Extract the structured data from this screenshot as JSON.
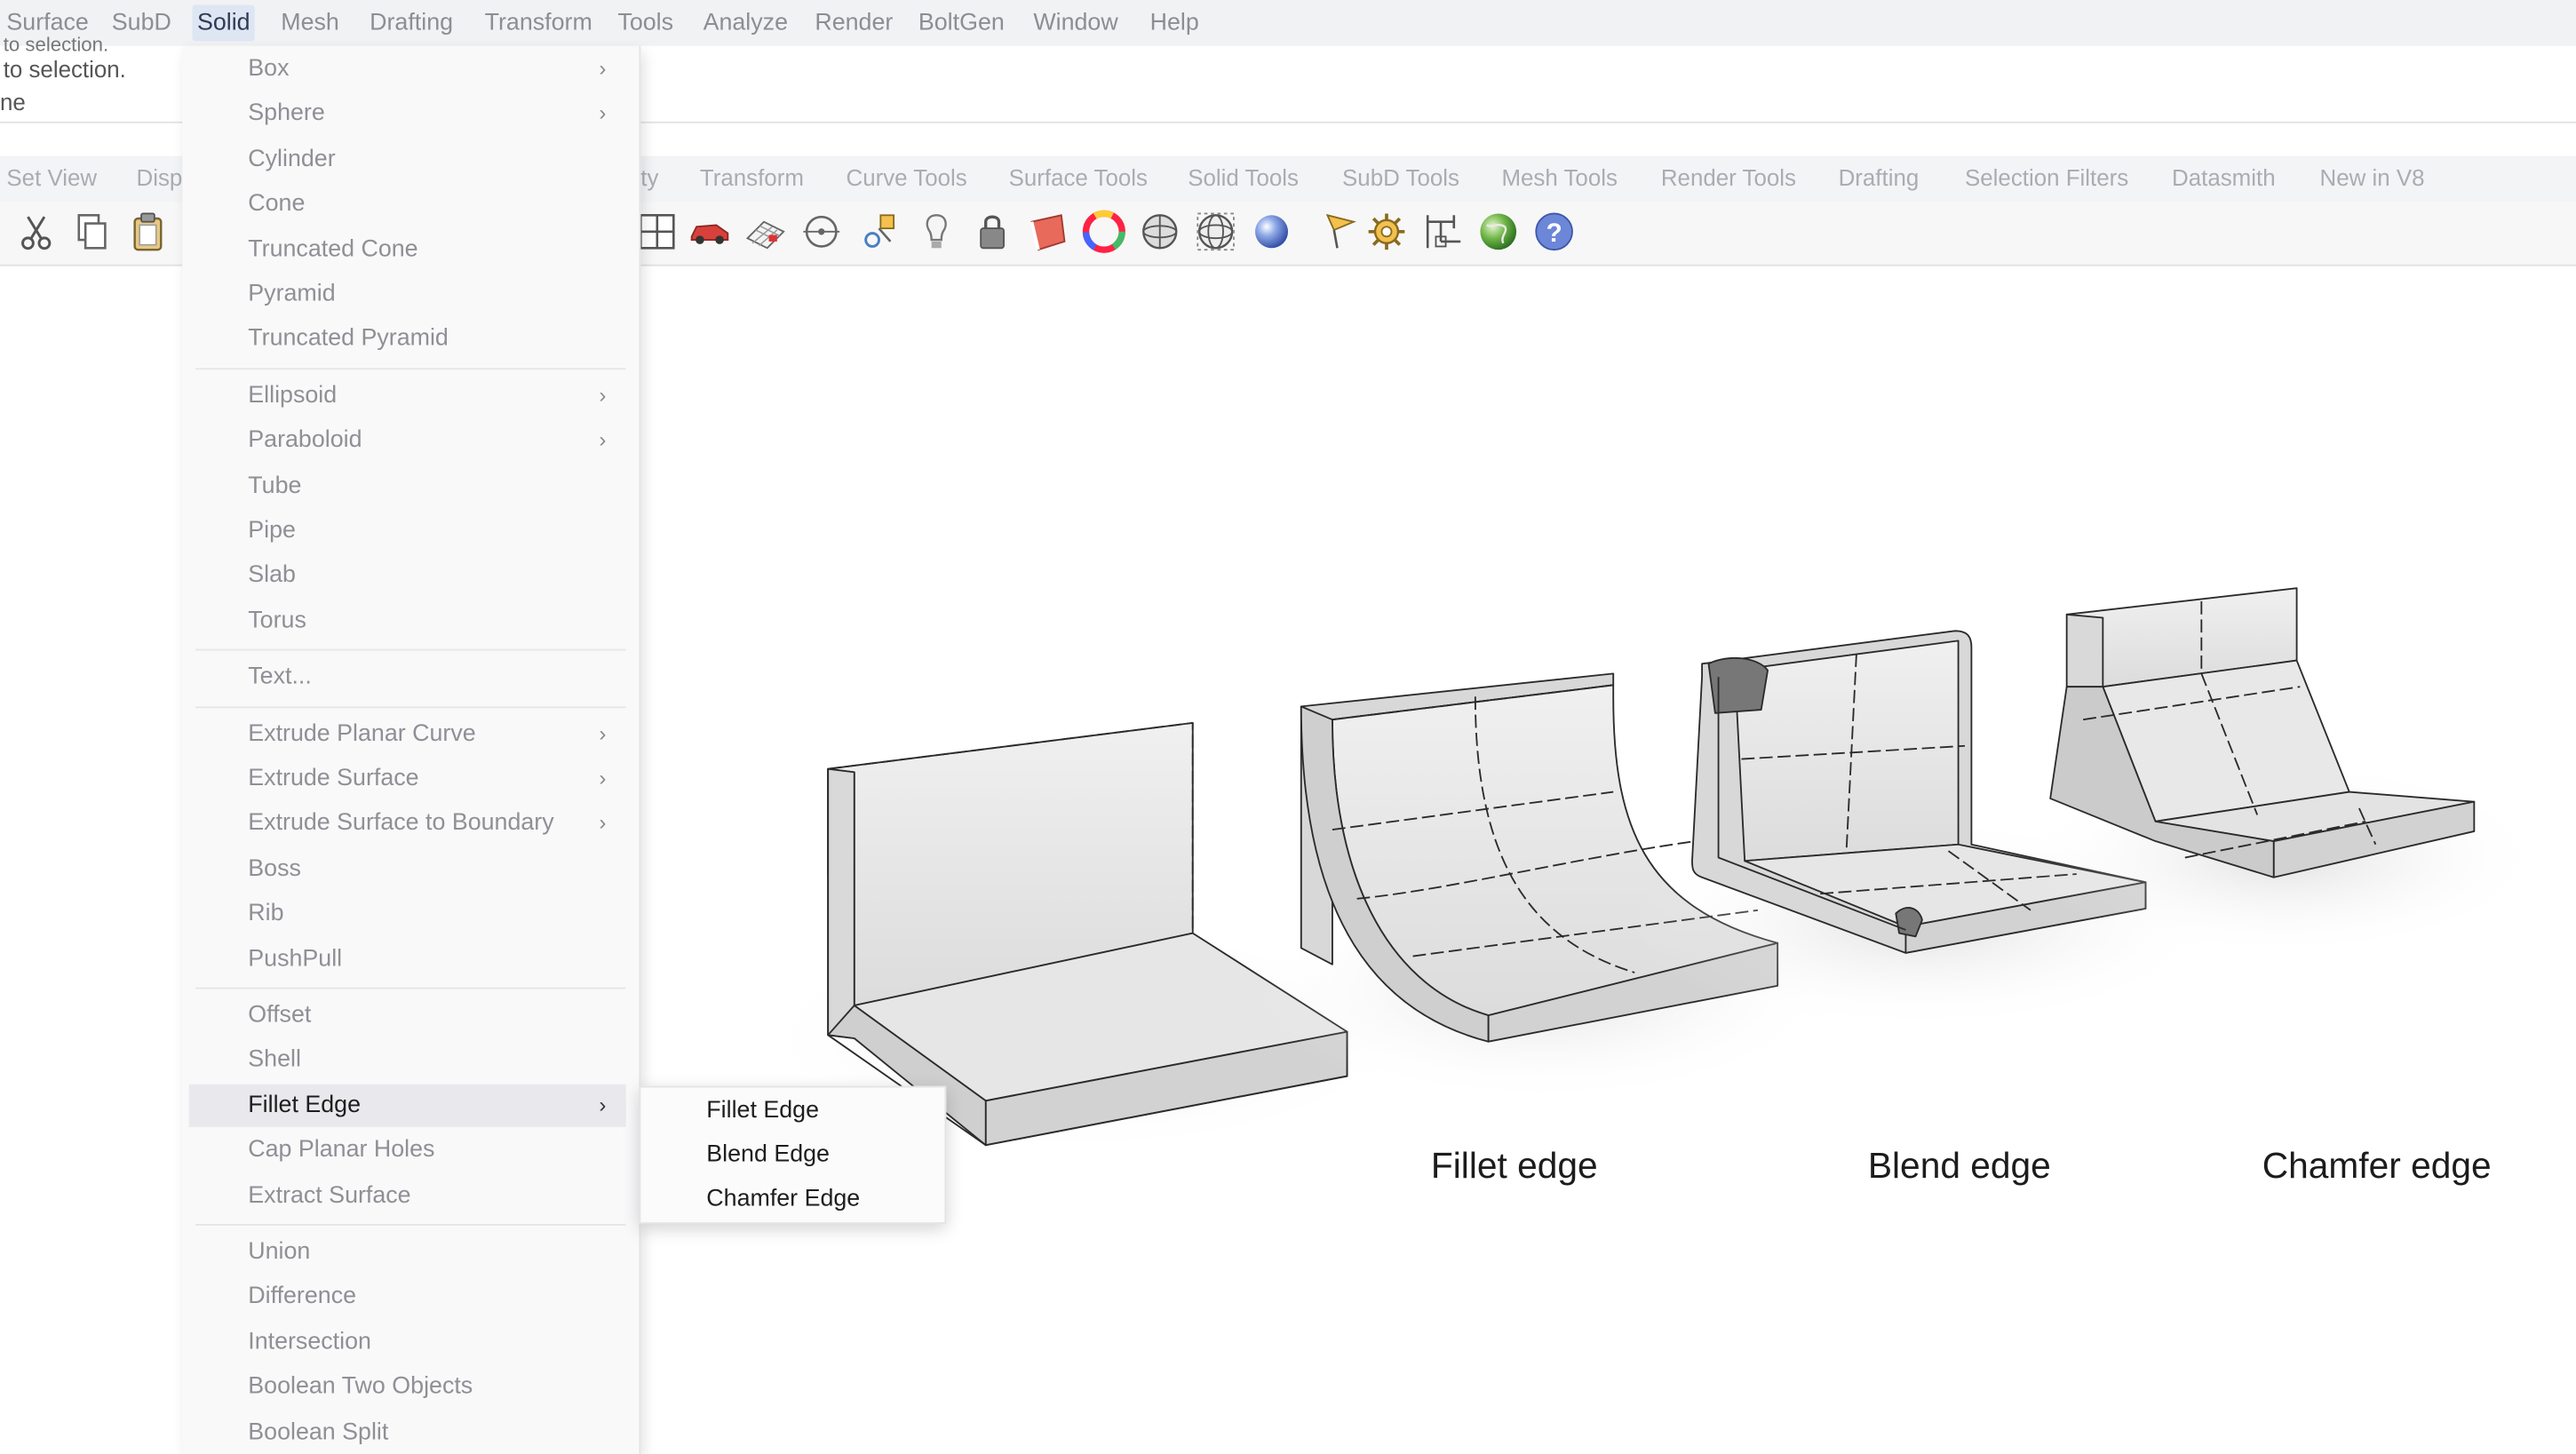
{
  "menubar": {
    "items": [
      "Surface",
      "SubD",
      "Solid",
      "Mesh",
      "Drafting",
      "Transform",
      "Tools",
      "Analyze",
      "Render",
      "BoltGen",
      "Window",
      "Help"
    ],
    "active": "Solid"
  },
  "command_history": {
    "line_top_partial": "to selection.",
    "line1": "to selection.",
    "line2": "ne"
  },
  "toolbar_tabs": {
    "left_items": [
      "Set View",
      "Disp"
    ],
    "partial_item": "ty",
    "items": [
      "Transform",
      "Curve Tools",
      "Surface Tools",
      "Solid Tools",
      "SubD Tools",
      "Mesh Tools",
      "Render Tools",
      "Drafting",
      "Selection Filters",
      "Datasmith",
      "New in V8"
    ]
  },
  "toolbar_icons": [
    "cut-icon",
    "copy-icon",
    "paste-icon",
    "four-viewports-icon",
    "car-icon",
    "grid-icon",
    "osnap-icon",
    "gumball-icon",
    "lightbulb-icon",
    "lock-icon",
    "layer-color-icon",
    "color-wheel-icon",
    "shaded-sphere-icon",
    "wireframe-sphere-icon",
    "rendered-sphere-icon",
    "flag-icon",
    "gear-icon",
    "dimension-icon",
    "globe-icon",
    "help-icon"
  ],
  "solid_menu": {
    "groups": [
      [
        {
          "label": "Box",
          "submenu": true
        },
        {
          "label": "Sphere",
          "submenu": true
        },
        {
          "label": "Cylinder",
          "submenu": false
        },
        {
          "label": "Cone",
          "submenu": false
        },
        {
          "label": "Truncated Cone",
          "submenu": false
        },
        {
          "label": "Pyramid",
          "submenu": false
        },
        {
          "label": "Truncated Pyramid",
          "submenu": false
        }
      ],
      [
        {
          "label": "Ellipsoid",
          "submenu": true
        },
        {
          "label": "Paraboloid",
          "submenu": true
        },
        {
          "label": "Tube",
          "submenu": false
        },
        {
          "label": "Pipe",
          "submenu": false
        },
        {
          "label": "Slab",
          "submenu": false
        },
        {
          "label": "Torus",
          "submenu": false
        }
      ],
      [
        {
          "label": "Text...",
          "submenu": false
        }
      ],
      [
        {
          "label": "Extrude Planar Curve",
          "submenu": true
        },
        {
          "label": "Extrude Surface",
          "submenu": true
        },
        {
          "label": "Extrude Surface to Boundary",
          "submenu": true
        },
        {
          "label": "Boss",
          "submenu": false
        },
        {
          "label": "Rib",
          "submenu": false
        },
        {
          "label": "PushPull",
          "submenu": false
        }
      ],
      [
        {
          "label": "Offset",
          "submenu": false
        },
        {
          "label": "Shell",
          "submenu": false
        },
        {
          "label": "Fillet Edge",
          "submenu": true,
          "highlighted": true
        },
        {
          "label": "Cap Planar Holes",
          "submenu": false
        },
        {
          "label": "Extract Surface",
          "submenu": false
        }
      ],
      [
        {
          "label": "Union",
          "submenu": false
        },
        {
          "label": "Difference",
          "submenu": false
        },
        {
          "label": "Intersection",
          "submenu": false
        },
        {
          "label": "Boolean Two Objects",
          "submenu": false
        },
        {
          "label": "Boolean Split",
          "submenu": false
        }
      ]
    ],
    "arrow_glyph": "›"
  },
  "fillet_submenu": {
    "items": [
      "Fillet Edge",
      "Blend Edge",
      "Chamfer Edge"
    ]
  },
  "viewport": {
    "captions": [
      "Fillet edge",
      "Blend edge",
      "Chamfer edge"
    ]
  },
  "colors": {
    "menubar_bg": "#f1f2f4",
    "active_menu_bg": "#dfe6f3",
    "menu_bg": "#f9f9fa",
    "menu_highlight_bg": "#e9e9ed",
    "disabled_text": "#8f8f95",
    "enabled_text": "#1e1e1e",
    "model_face": "#e8e8e8",
    "model_edge": "#2b2b2b"
  }
}
